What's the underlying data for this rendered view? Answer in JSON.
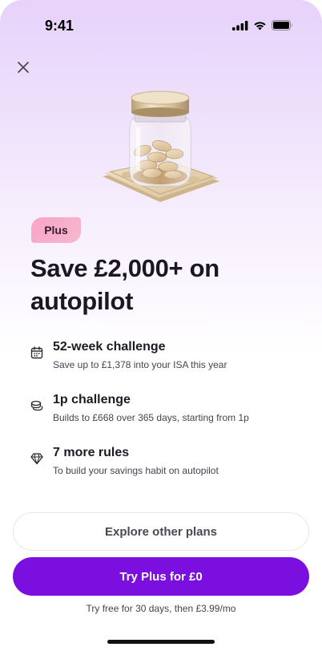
{
  "status_bar": {
    "time": "9:41"
  },
  "badge": {
    "label": "Plus"
  },
  "headline": {
    "line1": "Save £2,000+ on",
    "line2": "autopilot"
  },
  "features": [
    {
      "icon": "calendar-icon",
      "title": "52-week challenge",
      "subtitle": "Save up to £1,378 into your ISA this year"
    },
    {
      "icon": "coins-icon",
      "title": "1p challenge",
      "subtitle": "Builds to £668 over 365 days, starting from 1p"
    },
    {
      "icon": "diamond-icon",
      "title": "7 more rules",
      "subtitle": "To build your savings habit on autopilot"
    }
  ],
  "buttons": {
    "secondary_label": "Explore other plans",
    "primary_label": "Try Plus for £0"
  },
  "trial_note": "Try free for 30 days, then £3.99/mo",
  "colors": {
    "accent": "#7a0fe0",
    "badge": "#f8a4c4",
    "gradient_top": "#e7d2fb"
  }
}
